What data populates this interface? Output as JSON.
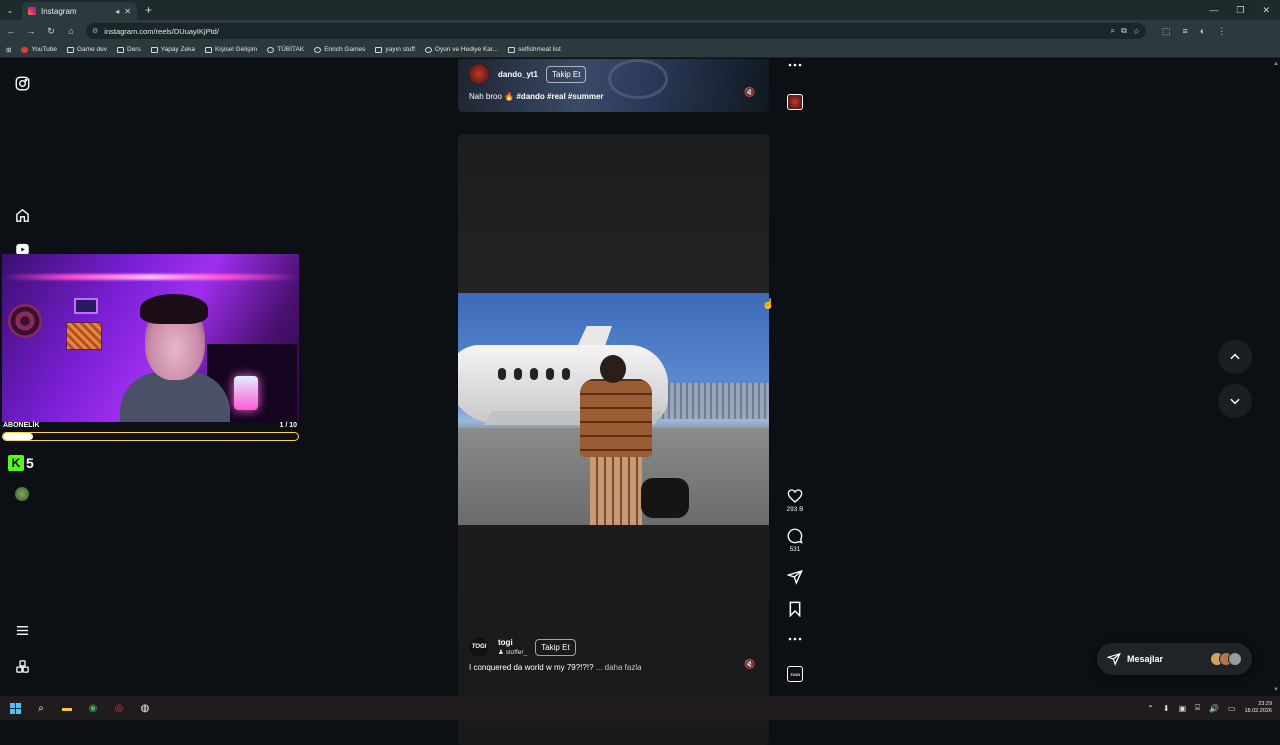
{
  "browser": {
    "tab_title": "Instagram",
    "url": "instagram.com/reels/DUuayIKjPtd/",
    "bookmarks": [
      "YouTube",
      "Game dev",
      "Ders",
      "Yapay Zeka",
      "Kişisel Gelişim",
      "TÜBİTAK",
      "Enrich Games",
      "yayın stuff",
      "Oyun ve Hediye Kar...",
      "selfishmeat list"
    ]
  },
  "overlay": {
    "sub_label": "ABONELİK",
    "sub_count": "1 / 10",
    "sub_progress": 0.1,
    "kick_count": "5"
  },
  "reel_top": {
    "username": "dando_yt1",
    "follow_label": "Takip Et",
    "caption_text": "Nah broo",
    "caption_tags": "#dando #real #summer"
  },
  "reel_main": {
    "username": "togi",
    "avatar_text": "TOGI",
    "audio": "stoffer_",
    "follow_label": "Takip Et",
    "caption": "I conquered da world w my 79?!?!?",
    "more_label": "... daha fazla"
  },
  "actions": {
    "likes": "293 B",
    "comments": "531"
  },
  "messages": {
    "label": "Mesajlar"
  },
  "taskbar": {
    "time": "23:29",
    "date": "18.02.2026"
  }
}
